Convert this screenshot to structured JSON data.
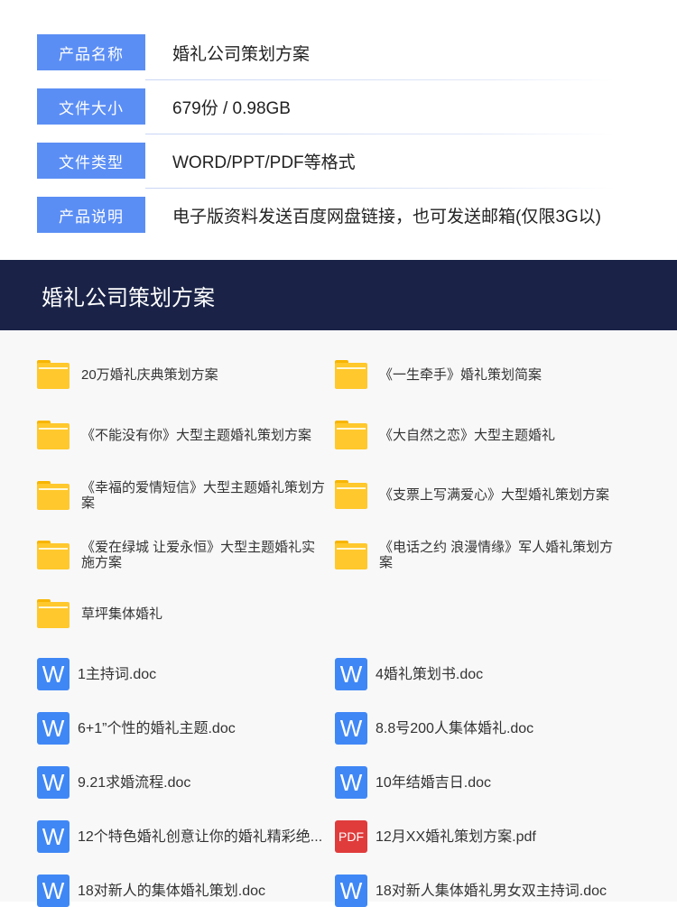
{
  "info": [
    {
      "label": "产品名称",
      "value": "婚礼公司策划方案"
    },
    {
      "label": "文件大小",
      "value": "679份 / 0.98GB"
    },
    {
      "label": "文件类型",
      "value": "WORD/PPT/PDF等格式"
    },
    {
      "label": "产品说明",
      "value": "电子版资料发送百度网盘链接，也可发送邮箱(仅限3G以)"
    }
  ],
  "banner_title": "婚礼公司策划方案",
  "folders": [
    "20万婚礼庆典策划方案",
    "《一生牵手》婚礼策划简案",
    "《不能没有你》大型主题婚礼策划方案",
    "《大自然之恋》大型主题婚礼",
    "《幸福的爱情短信》大型主题婚礼策划方案",
    "《支票上写满爱心》大型婚礼策划方案",
    "《爱在绿城 让爱永恒》大型主题婚礼实施方案",
    "《电话之约 浪漫情缘》军人婚礼策划方案",
    "草坪集体婚礼"
  ],
  "files": [
    {
      "name": "1主持词.doc",
      "type": "W"
    },
    {
      "name": "4婚礼策划书.doc",
      "type": "W"
    },
    {
      "name": "6+1”个性的婚礼主题.doc",
      "type": "W"
    },
    {
      "name": "8.8号200人集体婚礼.doc",
      "type": "W"
    },
    {
      "name": "9.21求婚流程.doc",
      "type": "W"
    },
    {
      "name": "10年结婚吉日.doc",
      "type": "W"
    },
    {
      "name": "12个特色婚礼创意让你的婚礼精彩绝...",
      "type": "W"
    },
    {
      "name": "12月XX婚礼策划方案.pdf",
      "type": "PDF"
    },
    {
      "name": "18对新人的集体婚礼策划.doc",
      "type": "W"
    },
    {
      "name": "18对新人集体婚礼男女双主持词.doc",
      "type": "W"
    }
  ]
}
